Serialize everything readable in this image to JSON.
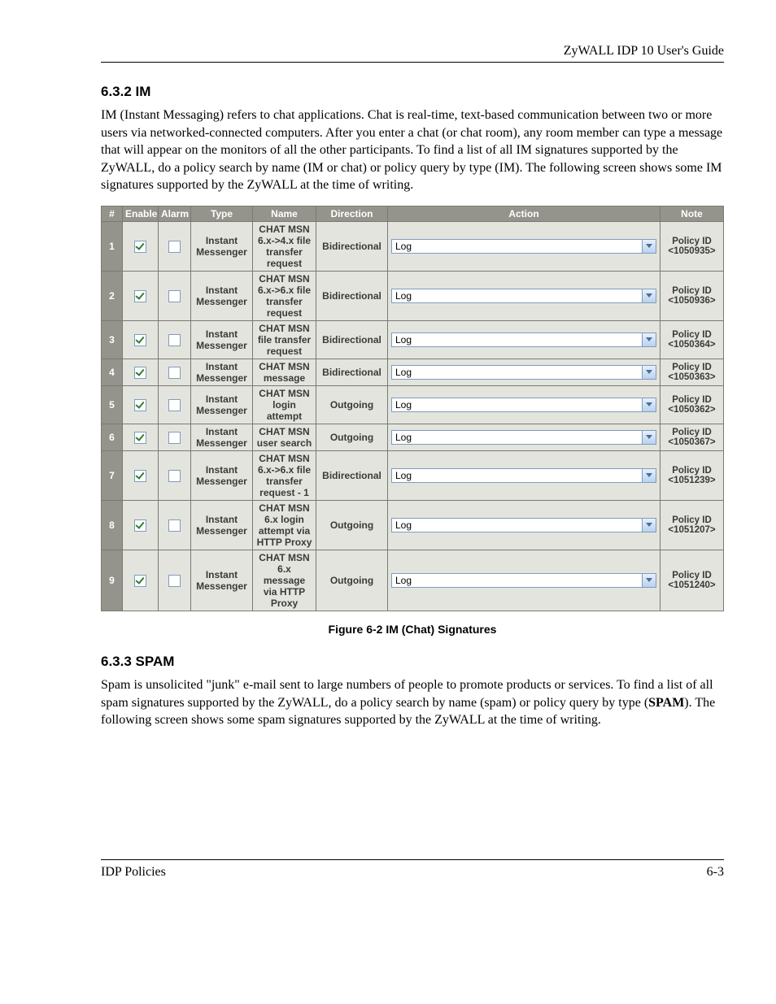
{
  "header": {
    "product_guide": "ZyWALL IDP 10 User's Guide"
  },
  "section_im": {
    "number_title": "6.3.2  IM",
    "paragraph": "IM (Instant Messaging) refers to chat applications. Chat is real-time, text-based communication between two or more users via networked-connected computers. After you enter a chat (or chat room), any room member can type a message that will appear on the monitors of all the other participants. To find a list of all IM signatures supported by the ZyWALL, do a policy search by name (IM or chat) or policy query by type (IM). The following screen shows some IM signatures supported by the ZyWALL at the time of writing."
  },
  "table": {
    "headers": {
      "idx": "#",
      "enable": "Enable",
      "alarm": "Alarm",
      "type": "Type",
      "name": "Name",
      "direction": "Direction",
      "action": "Action",
      "note": "Note"
    },
    "rows": [
      {
        "n": "1",
        "enable": true,
        "alarm": false,
        "type": "Instant Messenger",
        "name": "CHAT MSN 6.x->4.x file transfer request",
        "direction": "Bidirectional",
        "action": "Log",
        "note_label": "Policy ID",
        "note_id": "<1050935>"
      },
      {
        "n": "2",
        "enable": true,
        "alarm": false,
        "type": "Instant Messenger",
        "name": "CHAT MSN 6.x->6.x file transfer request",
        "direction": "Bidirectional",
        "action": "Log",
        "note_label": "Policy ID",
        "note_id": "<1050936>"
      },
      {
        "n": "3",
        "enable": true,
        "alarm": false,
        "type": "Instant Messenger",
        "name": "CHAT MSN file transfer request",
        "direction": "Bidirectional",
        "action": "Log",
        "note_label": "Policy ID",
        "note_id": "<1050364>"
      },
      {
        "n": "4",
        "enable": true,
        "alarm": false,
        "type": "Instant Messenger",
        "name": "CHAT MSN message",
        "direction": "Bidirectional",
        "action": "Log",
        "note_label": "Policy ID",
        "note_id": "<1050363>"
      },
      {
        "n": "5",
        "enable": true,
        "alarm": false,
        "type": "Instant Messenger",
        "name": "CHAT MSN login attempt",
        "direction": "Outgoing",
        "action": "Log",
        "note_label": "Policy ID",
        "note_id": "<1050362>"
      },
      {
        "n": "6",
        "enable": true,
        "alarm": false,
        "type": "Instant Messenger",
        "name": "CHAT MSN user search",
        "direction": "Outgoing",
        "action": "Log",
        "note_label": "Policy ID",
        "note_id": "<1050367>"
      },
      {
        "n": "7",
        "enable": true,
        "alarm": false,
        "type": "Instant Messenger",
        "name": "CHAT MSN 6.x->6.x file transfer request - 1",
        "direction": "Bidirectional",
        "action": "Log",
        "note_label": "Policy ID",
        "note_id": "<1051239>"
      },
      {
        "n": "8",
        "enable": true,
        "alarm": false,
        "type": "Instant Messenger",
        "name": "CHAT MSN 6.x login attempt via HTTP Proxy",
        "direction": "Outgoing",
        "action": "Log",
        "note_label": "Policy ID",
        "note_id": "<1051207>"
      },
      {
        "n": "9",
        "enable": true,
        "alarm": false,
        "type": "Instant Messenger",
        "name": "CHAT MSN 6.x message via HTTP Proxy",
        "direction": "Outgoing",
        "action": "Log",
        "note_label": "Policy ID",
        "note_id": "<1051240>"
      }
    ],
    "caption": "Figure 6-2 IM (Chat) Signatures"
  },
  "section_spam": {
    "number_title": "6.3.3  SPAM",
    "paragraph_pre": "Spam is unsolicited \"junk\" e-mail sent to large numbers of people to promote products or services. To find a list of all spam signatures supported by the ZyWALL, do a policy search by name (spam) or policy query by type (",
    "paragraph_bold": "SPAM",
    "paragraph_post": "). The following screen shows some spam signatures supported by the ZyWALL at the time of writing."
  },
  "footer": {
    "left": "IDP Policies",
    "right": "6-3"
  }
}
